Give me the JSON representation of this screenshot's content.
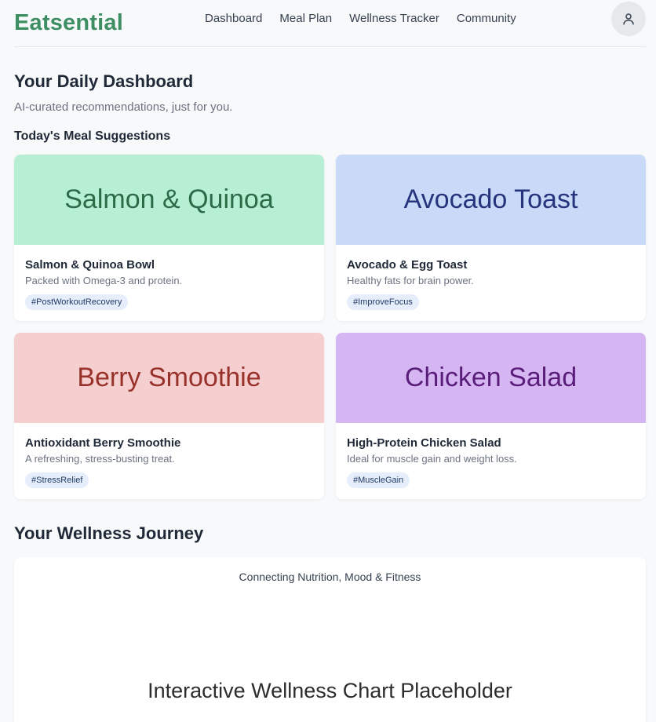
{
  "app": {
    "logo": "Eatsential"
  },
  "nav": [
    {
      "label": "Dashboard"
    },
    {
      "label": "Meal Plan"
    },
    {
      "label": "Wellness Tracker"
    },
    {
      "label": "Community"
    }
  ],
  "user": {
    "icon": "user-icon"
  },
  "dashboard": {
    "title": "Your Daily Dashboard",
    "subtitle": "AI-curated recommendations, just for you.",
    "section_title": "Today's Meal Suggestions"
  },
  "meals": [
    {
      "image_text": "Salmon & Quinoa",
      "image_bg": "#b7efd4",
      "image_color": "#2c6b48",
      "title": "Salmon & Quinoa Bowl",
      "description": "Packed with Omega-3 and protein.",
      "tag": "#PostWorkoutRecovery"
    },
    {
      "image_text": "Avocado Toast",
      "image_bg": "#c9daf8",
      "image_color": "#27337d",
      "title": "Avocado & Egg Toast",
      "description": "Healthy fats for brain power.",
      "tag": "#ImproveFocus"
    },
    {
      "image_text": "Berry Smoothie",
      "image_bg": "#f5cfcf",
      "image_color": "#98312a",
      "title": "Antioxidant Berry Smoothie",
      "description": "A refreshing, stress-busting treat.",
      "tag": "#StressRelief"
    },
    {
      "image_text": "Chicken Salad",
      "image_bg": "#d5b6f3",
      "image_color": "#5a1e7a",
      "title": "High-Protein Chicken Salad",
      "description": "Ideal for muscle gain and weight loss.",
      "tag": "#MuscleGain"
    }
  ],
  "journey": {
    "title": "Your Wellness Journey",
    "caption": "Connecting Nutrition, Mood & Fitness",
    "placeholder": "Interactive Wellness Chart Placeholder"
  },
  "colors": {
    "brand": "#3d8f63",
    "tag_bg": "#e6eefb",
    "tag_text": "#1e3a66"
  }
}
